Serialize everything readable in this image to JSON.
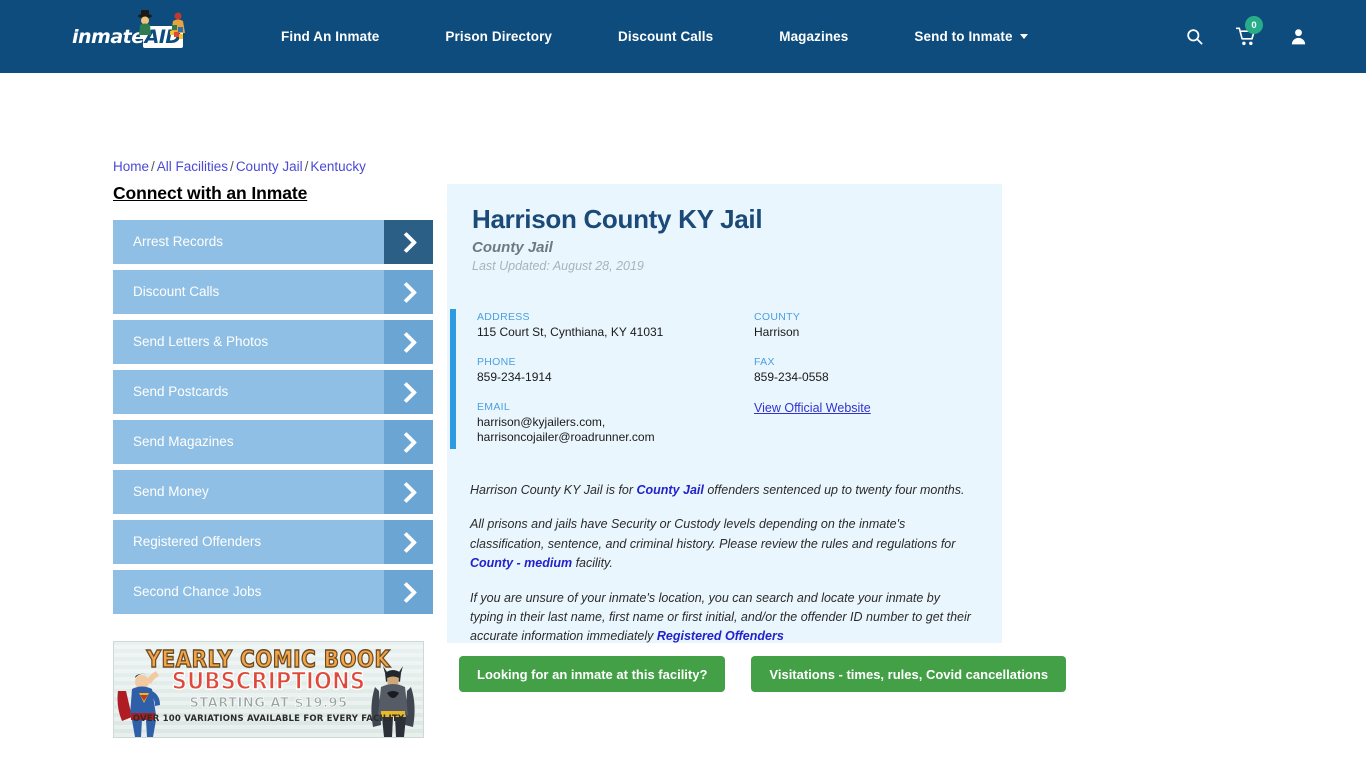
{
  "header": {
    "logo": {
      "text": "inmate",
      "badge": "AID",
      "alt": "inmateaid-logo"
    },
    "nav": [
      {
        "label": "Find An Inmate",
        "caret": false
      },
      {
        "label": "Prison Directory",
        "caret": false
      },
      {
        "label": "Discount Calls",
        "caret": false
      },
      {
        "label": "Magazines",
        "caret": false
      },
      {
        "label": "Send to Inmate",
        "caret": true
      }
    ],
    "icons": {
      "search": "search-icon",
      "cart": "shopping-cart-icon",
      "cart_count": "0",
      "account": "user-account-icon"
    },
    "colors": {
      "background": "#0e4c7d",
      "badge": "#27ae88"
    }
  },
  "breadcrumb": {
    "items": [
      "Home",
      "All Facilities",
      "County Jail",
      "Kentucky"
    ],
    "separator": "/"
  },
  "sidebar": {
    "title": "Connect with an Inmate",
    "items": [
      {
        "label": "Arrest Records",
        "active": true
      },
      {
        "label": "Discount Calls",
        "active": false
      },
      {
        "label": "Send Letters & Photos",
        "active": false
      },
      {
        "label": "Send Postcards",
        "active": false
      },
      {
        "label": "Send Magazines",
        "active": false
      },
      {
        "label": "Send Money",
        "active": false
      },
      {
        "label": "Registered Offenders",
        "active": false
      },
      {
        "label": "Second Chance Jobs",
        "active": false
      }
    ]
  },
  "ad": {
    "line1": "YEARLY COMIC BOOK",
    "line2": "SUBSCRIPTIONS",
    "line3": "STARTING AT $19.95",
    "line4": "OVER 100 VARIATIONS AVAILABLE FOR EVERY FACILITY"
  },
  "facility": {
    "name": "Harrison County KY Jail",
    "type": "County Jail",
    "last_updated": "Last Updated: August 28, 2019",
    "info": {
      "address_label": "ADDRESS",
      "address_value": "115 Court St, Cynthiana, KY 41031",
      "county_label": "COUNTY",
      "county_value": "Harrison",
      "phone_label": "PHONE",
      "phone_value": "859-234-1914",
      "fax_label": "FAX",
      "fax_value": "859-234-0558",
      "email_label": "EMAIL",
      "email_value_1": "harrison@kyjailers.com,",
      "email_value_2": "harrisoncojailer@roadrunner.com",
      "website_link": "View Official Website"
    },
    "description": {
      "p1_a": "Harrison County KY Jail is for ",
      "p1_link": "County Jail",
      "p1_b": " offenders sentenced up to twenty four months.",
      "p2_a": "All prisons and jails have Security or Custody levels depending on the inmate's classification, sentence, and criminal history. Please review the rules and regulations for ",
      "p2_link": "County - medium",
      "p2_b": " facility.",
      "p3_a": "If you are unsure of your inmate's location, you can search and locate your inmate by typing in their last name, first name or first initial, and/or the offender ID number to get their accurate information immediately ",
      "p3_link": "Registered Offenders"
    }
  },
  "cta": {
    "buttons": [
      {
        "label": "Looking for an inmate at this facility?"
      },
      {
        "label": "Visitations - times, rules, Covid cancellations"
      }
    ],
    "color": "#43a047"
  }
}
